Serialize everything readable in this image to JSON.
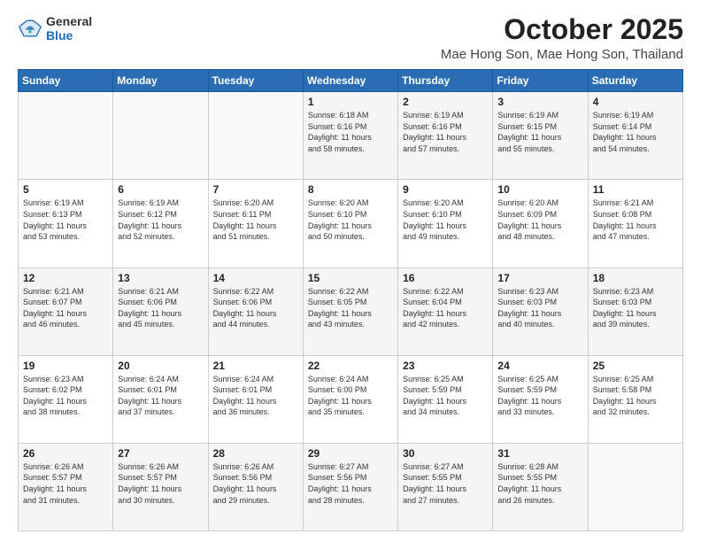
{
  "logo": {
    "general": "General",
    "blue": "Blue"
  },
  "header": {
    "month_title": "October 2025",
    "location": "Mae Hong Son, Mae Hong Son, Thailand"
  },
  "weekdays": [
    "Sunday",
    "Monday",
    "Tuesday",
    "Wednesday",
    "Thursday",
    "Friday",
    "Saturday"
  ],
  "weeks": [
    [
      {
        "day": "",
        "info": ""
      },
      {
        "day": "",
        "info": ""
      },
      {
        "day": "",
        "info": ""
      },
      {
        "day": "1",
        "info": "Sunrise: 6:18 AM\nSunset: 6:16 PM\nDaylight: 11 hours\nand 58 minutes."
      },
      {
        "day": "2",
        "info": "Sunrise: 6:19 AM\nSunset: 6:16 PM\nDaylight: 11 hours\nand 57 minutes."
      },
      {
        "day": "3",
        "info": "Sunrise: 6:19 AM\nSunset: 6:15 PM\nDaylight: 11 hours\nand 55 minutes."
      },
      {
        "day": "4",
        "info": "Sunrise: 6:19 AM\nSunset: 6:14 PM\nDaylight: 11 hours\nand 54 minutes."
      }
    ],
    [
      {
        "day": "5",
        "info": "Sunrise: 6:19 AM\nSunset: 6:13 PM\nDaylight: 11 hours\nand 53 minutes."
      },
      {
        "day": "6",
        "info": "Sunrise: 6:19 AM\nSunset: 6:12 PM\nDaylight: 11 hours\nand 52 minutes."
      },
      {
        "day": "7",
        "info": "Sunrise: 6:20 AM\nSunset: 6:11 PM\nDaylight: 11 hours\nand 51 minutes."
      },
      {
        "day": "8",
        "info": "Sunrise: 6:20 AM\nSunset: 6:10 PM\nDaylight: 11 hours\nand 50 minutes."
      },
      {
        "day": "9",
        "info": "Sunrise: 6:20 AM\nSunset: 6:10 PM\nDaylight: 11 hours\nand 49 minutes."
      },
      {
        "day": "10",
        "info": "Sunrise: 6:20 AM\nSunset: 6:09 PM\nDaylight: 11 hours\nand 48 minutes."
      },
      {
        "day": "11",
        "info": "Sunrise: 6:21 AM\nSunset: 6:08 PM\nDaylight: 11 hours\nand 47 minutes."
      }
    ],
    [
      {
        "day": "12",
        "info": "Sunrise: 6:21 AM\nSunset: 6:07 PM\nDaylight: 11 hours\nand 46 minutes."
      },
      {
        "day": "13",
        "info": "Sunrise: 6:21 AM\nSunset: 6:06 PM\nDaylight: 11 hours\nand 45 minutes."
      },
      {
        "day": "14",
        "info": "Sunrise: 6:22 AM\nSunset: 6:06 PM\nDaylight: 11 hours\nand 44 minutes."
      },
      {
        "day": "15",
        "info": "Sunrise: 6:22 AM\nSunset: 6:05 PM\nDaylight: 11 hours\nand 43 minutes."
      },
      {
        "day": "16",
        "info": "Sunrise: 6:22 AM\nSunset: 6:04 PM\nDaylight: 11 hours\nand 42 minutes."
      },
      {
        "day": "17",
        "info": "Sunrise: 6:23 AM\nSunset: 6:03 PM\nDaylight: 11 hours\nand 40 minutes."
      },
      {
        "day": "18",
        "info": "Sunrise: 6:23 AM\nSunset: 6:03 PM\nDaylight: 11 hours\nand 39 minutes."
      }
    ],
    [
      {
        "day": "19",
        "info": "Sunrise: 6:23 AM\nSunset: 6:02 PM\nDaylight: 11 hours\nand 38 minutes."
      },
      {
        "day": "20",
        "info": "Sunrise: 6:24 AM\nSunset: 6:01 PM\nDaylight: 11 hours\nand 37 minutes."
      },
      {
        "day": "21",
        "info": "Sunrise: 6:24 AM\nSunset: 6:01 PM\nDaylight: 11 hours\nand 36 minutes."
      },
      {
        "day": "22",
        "info": "Sunrise: 6:24 AM\nSunset: 6:00 PM\nDaylight: 11 hours\nand 35 minutes."
      },
      {
        "day": "23",
        "info": "Sunrise: 6:25 AM\nSunset: 5:59 PM\nDaylight: 11 hours\nand 34 minutes."
      },
      {
        "day": "24",
        "info": "Sunrise: 6:25 AM\nSunset: 5:59 PM\nDaylight: 11 hours\nand 33 minutes."
      },
      {
        "day": "25",
        "info": "Sunrise: 6:25 AM\nSunset: 5:58 PM\nDaylight: 11 hours\nand 32 minutes."
      }
    ],
    [
      {
        "day": "26",
        "info": "Sunrise: 6:26 AM\nSunset: 5:57 PM\nDaylight: 11 hours\nand 31 minutes."
      },
      {
        "day": "27",
        "info": "Sunrise: 6:26 AM\nSunset: 5:57 PM\nDaylight: 11 hours\nand 30 minutes."
      },
      {
        "day": "28",
        "info": "Sunrise: 6:26 AM\nSunset: 5:56 PM\nDaylight: 11 hours\nand 29 minutes."
      },
      {
        "day": "29",
        "info": "Sunrise: 6:27 AM\nSunset: 5:56 PM\nDaylight: 11 hours\nand 28 minutes."
      },
      {
        "day": "30",
        "info": "Sunrise: 6:27 AM\nSunset: 5:55 PM\nDaylight: 11 hours\nand 27 minutes."
      },
      {
        "day": "31",
        "info": "Sunrise: 6:28 AM\nSunset: 5:55 PM\nDaylight: 11 hours\nand 26 minutes."
      },
      {
        "day": "",
        "info": ""
      }
    ]
  ]
}
